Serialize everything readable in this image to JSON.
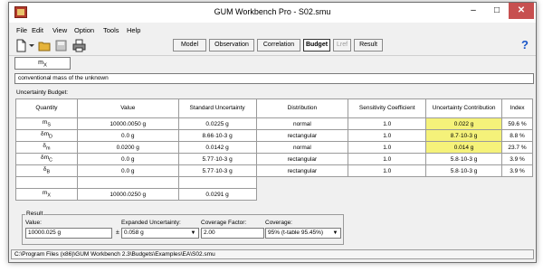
{
  "window": {
    "title": "GUM Workbench Pro - S02.smu",
    "minimize": "–",
    "maximize": "□",
    "close": "✕"
  },
  "menu": [
    "File",
    "Edit",
    "View",
    "Option",
    "Tools",
    "Help"
  ],
  "toolbar": {
    "icons": [
      "new-file-icon",
      "dropdown-icon",
      "open-folder-icon",
      "save-icon",
      "print-icon"
    ],
    "tabs": [
      {
        "label": "Model",
        "state": "normal"
      },
      {
        "label": "Observation",
        "state": "normal"
      },
      {
        "label": "Correlation",
        "state": "normal"
      },
      {
        "label": "Budget",
        "state": "active"
      },
      {
        "label": "Lref",
        "state": "disabled"
      },
      {
        "label": "Result",
        "state": "normal"
      }
    ],
    "help": "?"
  },
  "quantity_tab": {
    "main": "m",
    "sub": "X"
  },
  "description": "conventional mass of the unknown",
  "budget": {
    "label": "Uncertainty Budget:",
    "headers": [
      "Quantity",
      "Value",
      "Standard Uncertainty",
      "Distribution",
      "Sensitivity Coefficient",
      "Uncertainty Contribution",
      "Index"
    ],
    "rows": [
      {
        "q": "m",
        "qsub": "S",
        "value": "10000.0050 g",
        "su": "0.0225 g",
        "dist": "normal",
        "sens": "1.0",
        "contrib": "0.022 g",
        "index": "59.6 %",
        "hl": true
      },
      {
        "q": "δm",
        "qsub": "D",
        "value": "0.0 g",
        "su": "8.66·10-3 g",
        "dist": "rectangular",
        "sens": "1.0",
        "contrib": "8.7·10-3 g",
        "index": "8.8 %",
        "hl": true
      },
      {
        "q": "δ",
        "qsub": "m",
        "value": "0.0200 g",
        "su": "0.0142 g",
        "dist": "normal",
        "sens": "1.0",
        "contrib": "0.014 g",
        "index": "23.7 %",
        "hl": true
      },
      {
        "q": "δm",
        "qsub": "C",
        "value": "0.0 g",
        "su": "5.77·10-3 g",
        "dist": "rectangular",
        "sens": "1.0",
        "contrib": "5.8·10-3 g",
        "index": "3.9 %",
        "hl": false
      },
      {
        "q": "δ",
        "qsub": "B",
        "value": "0.0 g",
        "su": "5.77·10-3 g",
        "dist": "rectangular",
        "sens": "1.0",
        "contrib": "5.8·10-3 g",
        "index": "3.9 %",
        "hl": false
      }
    ],
    "summary": {
      "q": "m",
      "qsub": "X",
      "value": "10000.0250 g",
      "su": "0.0291 g"
    }
  },
  "result": {
    "title": "Result",
    "value_label": "Value:",
    "value": "10000.025 g",
    "pm": "±",
    "expanded_label": "Expanded Uncertainty:",
    "expanded": "0.058 g",
    "coverage_factor_label": "Coverage Factor:",
    "coverage_factor": "2.00",
    "coverage_label": "Coverage:",
    "coverage": "95% (t-table 95.45%)"
  },
  "status": "C:\\Program Files (x86)\\GUM Workbench 2.3\\Budgets\\Examples\\EA\\S02.smu",
  "colors": {
    "highlight": "#f5f27a",
    "close_button": "#c75050"
  }
}
